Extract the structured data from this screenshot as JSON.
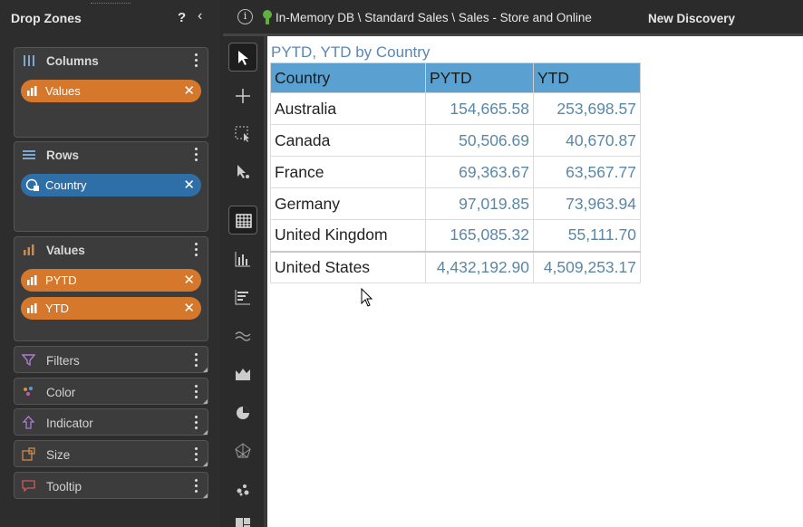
{
  "drop_zones": {
    "title": "Drop Zones",
    "help": "?",
    "collapse": "‹",
    "zones": {
      "columns": {
        "label": "Columns",
        "items": [
          {
            "label": "Values",
            "color": "orange"
          }
        ]
      },
      "rows": {
        "label": "Rows",
        "items": [
          {
            "label": "Country",
            "color": "blue"
          }
        ]
      },
      "values": {
        "label": "Values",
        "items": [
          {
            "label": "PYTD",
            "color": "orange"
          },
          {
            "label": "YTD",
            "color": "orange"
          }
        ]
      }
    },
    "feature_zones": [
      {
        "label": "Filters",
        "icon": "filter-icon"
      },
      {
        "label": "Color",
        "icon": "color-icon"
      },
      {
        "label": "Indicator",
        "icon": "indicator-icon"
      },
      {
        "label": "Size",
        "icon": "size-icon"
      },
      {
        "label": "Tooltip",
        "icon": "tooltip-icon"
      }
    ],
    "close_glyph": "✕"
  },
  "topbar": {
    "info": "i",
    "path": "In-Memory DB \\ Standard Sales \\ Sales - Store and Online",
    "discovery": "New Discovery"
  },
  "colors": {
    "accent_orange": "#d6782c",
    "accent_blue": "#2f6fa8",
    "header_blue": "#5aa0d0",
    "value_blue": "#5b87a6"
  },
  "grid": {
    "title": "PYTD, YTD by Country",
    "columns": [
      "Country",
      "PYTD",
      "YTD"
    ],
    "rows": [
      {
        "country": "Australia",
        "pytd": "154,665.58",
        "ytd": "253,698.57"
      },
      {
        "country": "Canada",
        "pytd": "50,506.69",
        "ytd": "40,670.87"
      },
      {
        "country": "France",
        "pytd": "69,363.67",
        "ytd": "63,567.77"
      },
      {
        "country": "Germany",
        "pytd": "97,019.85",
        "ytd": "73,963.94"
      },
      {
        "country": "United Kingdom",
        "pytd": "165,085.32",
        "ytd": "55,111.70"
      },
      {
        "country": "United States",
        "pytd": "4,432,192.90",
        "ytd": "4,509,253.17"
      }
    ]
  }
}
